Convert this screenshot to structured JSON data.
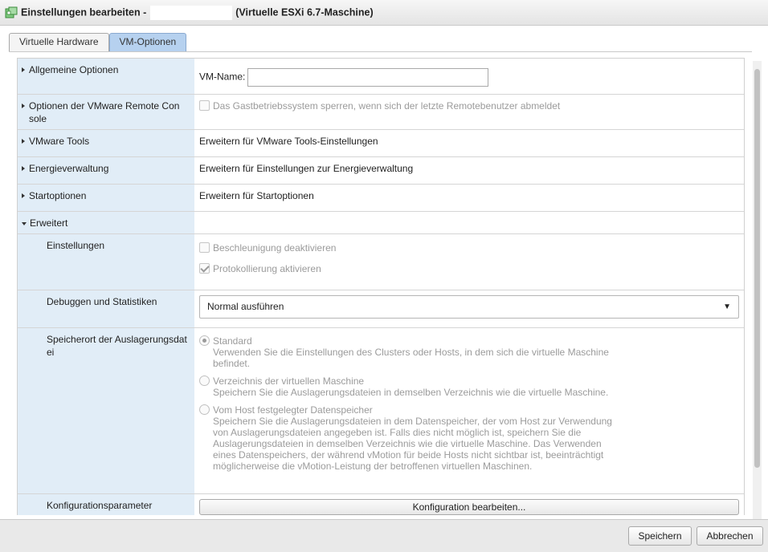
{
  "window": {
    "title_prefix": "Einstellungen bearbeiten -",
    "title_suffix": "(Virtuelle ESXi 6.7-Maschine)"
  },
  "tabs": [
    {
      "label": "Virtuelle Hardware"
    },
    {
      "label": "VM-Optionen"
    }
  ],
  "rows": {
    "general": {
      "label": "Allgemeine Optionen",
      "vm_name_label": "VM-Name:",
      "vm_name_value": ""
    },
    "remote_console": {
      "label": "Optionen der VMware Remote Console",
      "lock_guest_label": "Das Gastbetriebssystem sperren, wenn sich der letzte Remotebenutzer abmeldet"
    },
    "vmware_tools": {
      "label": "VMware Tools",
      "value": "Erweitern für VMware Tools-Einstellungen"
    },
    "power": {
      "label": "Energieverwaltung",
      "value": "Erweitern für Einstellungen zur Energieverwaltung"
    },
    "boot": {
      "label": "Startoptionen",
      "value": "Erweitern für Startoptionen"
    },
    "advanced": {
      "label": "Erweitert"
    },
    "settings": {
      "label": "Einstellungen",
      "disable_accel_label": "Beschleunigung deaktivieren",
      "enable_logging_label": "Protokollierung aktivieren"
    },
    "debug": {
      "label": "Debuggen und Statistiken",
      "selected": "Normal ausführen"
    },
    "swapfile": {
      "label": "Speicherort der Auslagerungsdatei",
      "options": [
        {
          "title": "Standard",
          "desc": "Verwenden Sie die Einstellungen des Clusters oder Hosts, in dem sich die virtuelle Maschine befindet."
        },
        {
          "title": "Verzeichnis der virtuellen Maschine",
          "desc": "Speichern Sie die Auslagerungsdateien in demselben Verzeichnis wie die virtuelle Maschine."
        },
        {
          "title": "Vom Host festgelegter Datenspeicher",
          "desc": "Speichern Sie die Auslagerungsdateien in dem Datenspeicher, der vom Host zur Verwendung von Auslagerungsdateien angegeben ist. Falls dies nicht möglich ist, speichern Sie die Auslagerungsdateien in demselben Verzeichnis wie die virtuelle Maschine. Das Verwenden eines Datenspeichers, der während vMotion für beide Hosts nicht sichtbar ist, beeinträchtigt möglicherweise die vMotion-Leistung der betroffenen virtuellen Maschinen."
        }
      ]
    },
    "config": {
      "label": "Konfigurationsparameter",
      "button": "Konfiguration bearbeiten..."
    }
  },
  "footer": {
    "save": "Speichern",
    "cancel": "Abbrechen"
  }
}
